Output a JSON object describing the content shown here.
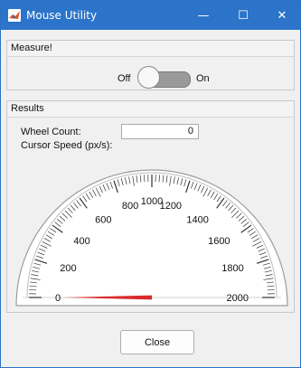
{
  "window": {
    "title": "Mouse Utility"
  },
  "window_controls": {
    "minimize": "—",
    "maximize": "☐",
    "close": "✕"
  },
  "measure_panel": {
    "title": "Measure!",
    "toggle_off_label": "Off",
    "toggle_on_label": "On",
    "toggle_state": "Off"
  },
  "results_panel": {
    "title": "Results",
    "wheel_count_label": "Wheel Count:",
    "wheel_count_value": "0",
    "cursor_speed_label": "Cursor Speed (px/s):"
  },
  "gauge": {
    "min": 0,
    "max": 2000,
    "value": 0,
    "tick_labels": [
      "0",
      "200",
      "400",
      "600",
      "800",
      "1000",
      "1200",
      "1400",
      "1600",
      "1800",
      "2000"
    ],
    "needle_color": "#d92b2b"
  },
  "close_button": {
    "label": "Close"
  }
}
